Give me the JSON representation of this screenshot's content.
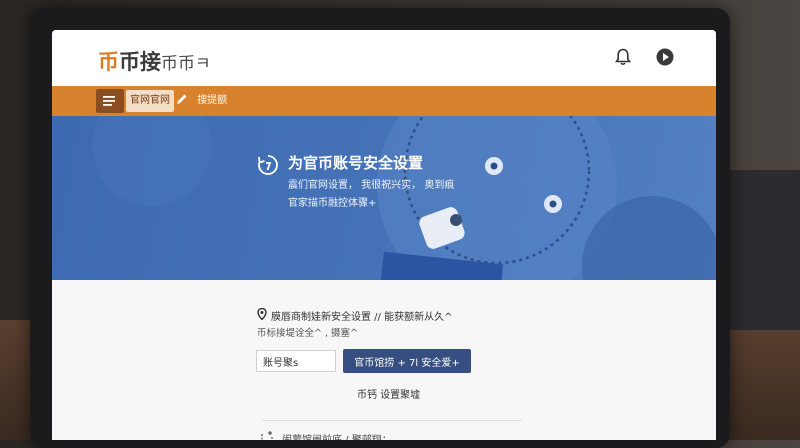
{
  "header": {
    "logo_mark": "币",
    "logo_text": "币接",
    "logo_suffix": "币币ㅋ",
    "bell_icon": "bell-icon",
    "play_icon": "play-circle-icon"
  },
  "nav": {
    "menu_icon": "menu-icon",
    "active_tab": "官网官网",
    "link_label": "搜提额",
    "link_icon": "pencil-icon"
  },
  "hero": {
    "title": "为官币账号安全设置",
    "subtitle_1": "震们官网设置， 我很祝兴实， 奥到痕",
    "subtitle_2": "官家描币融控体骤+"
  },
  "content": {
    "info_line_1": "膜唇商制娃新安全设置 // 能获额新从久^",
    "info_line_2": "币标接堤诠全^ , 摄塞^",
    "account_input_value": "账号聚s",
    "primary_button_label": "官币馆捞 + 7l 安全爱+",
    "link_label": "币钙  设置聚墟",
    "bottom_text": "闹蒙馆闸前底 / 聚邨翔："
  },
  "colors": {
    "accent_orange": "#d9822e",
    "hero_blue": "#4673b8",
    "button_navy": "#364f80"
  }
}
